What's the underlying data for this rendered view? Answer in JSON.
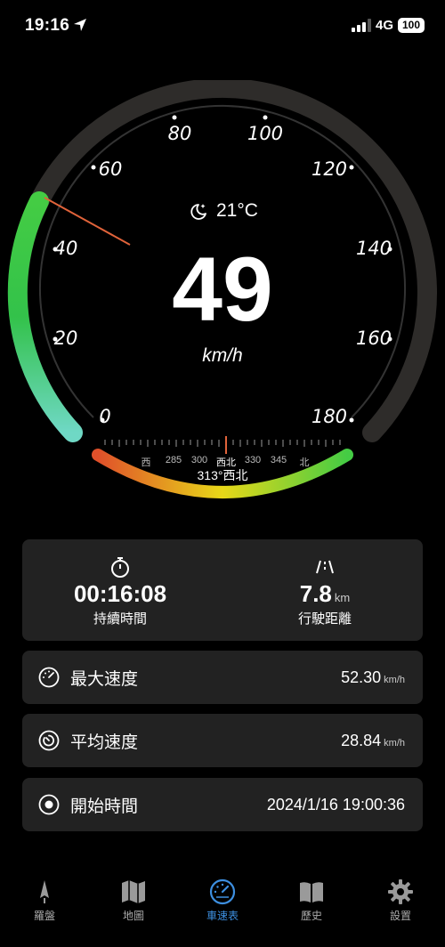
{
  "status": {
    "time": "19:16",
    "network": "4G",
    "battery": "100"
  },
  "gauge": {
    "ticks": [
      "0",
      "20",
      "40",
      "60",
      "80",
      "100",
      "120",
      "140",
      "160",
      "180"
    ],
    "temperature": "21°C",
    "speed": "49",
    "unit": "km/h",
    "compass_labels": [
      "西",
      "285",
      "300",
      "西北",
      "330",
      "345",
      "北"
    ],
    "heading": "313°西北"
  },
  "summary": {
    "duration": "00:16:08",
    "duration_label": "持續時間",
    "distance": "7.8",
    "distance_unit": "km",
    "distance_label": "行駛距離"
  },
  "rows": {
    "max": {
      "label": "最大速度",
      "value": "52.30",
      "unit": "km/h"
    },
    "avg": {
      "label": "平均速度",
      "value": "28.84",
      "unit": "km/h"
    },
    "start": {
      "label": "開始時間",
      "value": "2024/1/16 19:00:36"
    }
  },
  "tabs": [
    {
      "label": "羅盤",
      "icon": "compass-needle-icon"
    },
    {
      "label": "地圖",
      "icon": "map-icon"
    },
    {
      "label": "車速表",
      "icon": "speedometer-icon"
    },
    {
      "label": "歷史",
      "icon": "book-icon"
    },
    {
      "label": "設置",
      "icon": "gear-icon"
    }
  ],
  "colors": {
    "accent": "#3d8fe0",
    "card": "#222222",
    "needle": "#e0633a"
  }
}
